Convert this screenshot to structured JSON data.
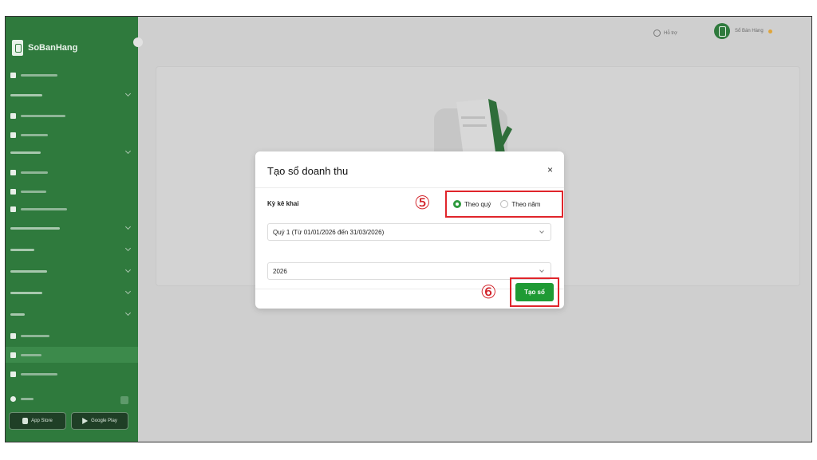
{
  "brand": {
    "name": "SoBanHang"
  },
  "header": {
    "help_label": "Hỗ trợ",
    "user_name": "Sổ Bán Hàng"
  },
  "sidebar": {
    "store_buttons": [
      {
        "label": "App Store",
        "icon": "apple-icon"
      },
      {
        "label": "Google Play",
        "icon": "google-play-icon"
      }
    ]
  },
  "modal": {
    "title": "Tạo sổ doanh thu",
    "close_label": "×",
    "period_label": "Kỳ kê khai",
    "options": [
      {
        "label": "Theo quý",
        "selected": true
      },
      {
        "label": "Theo năm",
        "selected": false
      }
    ],
    "quarter_value": "Quý 1 (Từ 01/01/2026 đến 31/03/2026)",
    "year_value": "2026",
    "create_button": "Tạo sổ",
    "step_markers": [
      "⑤",
      "⑥"
    ]
  },
  "colors": {
    "sidebar": "#2f7a3d",
    "primary_button": "#1f9a34",
    "highlight": "#e0252b"
  }
}
